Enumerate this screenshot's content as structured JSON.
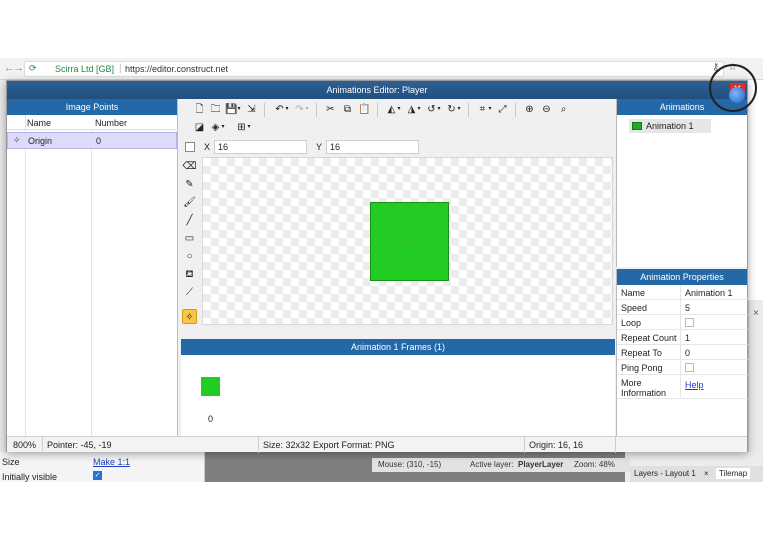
{
  "browser": {
    "secure_label": "Scirra Ltd [GB]",
    "url": "https://editor.construct.net"
  },
  "dialog": {
    "title": "Animations Editor: Player",
    "close_icon": "close-icon"
  },
  "image_points": {
    "header": "Image Points",
    "columns": [
      "Name",
      "Number"
    ],
    "rows": [
      {
        "name": "Origin",
        "number": "0"
      }
    ]
  },
  "position": {
    "x_label": "X",
    "x_value": "16",
    "y_label": "Y",
    "y_value": "16"
  },
  "frames": {
    "header": "Animation 1 Frames (1)",
    "items": [
      {
        "index": "0"
      }
    ]
  },
  "animations": {
    "header": "Animations",
    "items": [
      "Animation 1"
    ]
  },
  "properties": {
    "header": "Animation Properties",
    "rows": [
      {
        "key": "Name",
        "value": "Animation 1",
        "type": "text"
      },
      {
        "key": "Speed",
        "value": "5",
        "type": "text"
      },
      {
        "key": "Loop",
        "value": "",
        "type": "checkbox"
      },
      {
        "key": "Repeat Count",
        "value": "1",
        "type": "text"
      },
      {
        "key": "Repeat To",
        "value": "0",
        "type": "text"
      },
      {
        "key": "Ping Pong",
        "value": "",
        "type": "checkbox"
      },
      {
        "key": "More Information",
        "value": "Help",
        "type": "link"
      }
    ]
  },
  "status": {
    "zoom": "800%",
    "pointer": "Pointer: -45, -19",
    "size": "Size: 32x32",
    "export_format": "Export Format: PNG",
    "origin": "Origin: 16, 16"
  },
  "background_ide": {
    "size_label": "Size",
    "make_link": "Make 1:1",
    "initially_visible": "Initially visible",
    "mouse": "Mouse: (310, -15)",
    "active_layer_label": "Active layer:",
    "active_layer": "PlayerLayer",
    "zoom": "Zoom: 48%",
    "tab_layers": "Layers - Layout 1",
    "tab_tilemap": "Tilemap"
  },
  "colors": {
    "title_bar": "#21507f",
    "panel_header": "#2468a8",
    "sprite_fill": "#22cc22",
    "selected_row": "#dcdcfa",
    "origin_tool": "#f7c74a"
  }
}
